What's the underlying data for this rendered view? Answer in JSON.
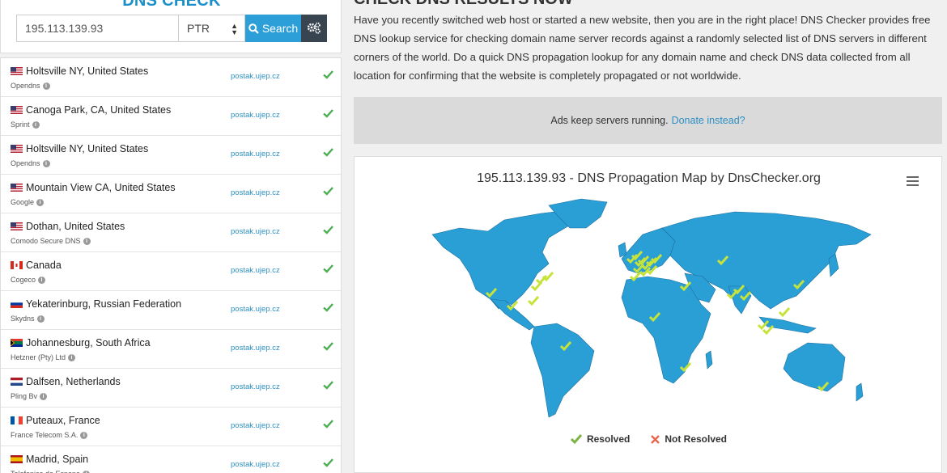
{
  "left": {
    "title": "DNS CHECK",
    "domain_value": "195.113.139.93",
    "record_type": "PTR",
    "search_label": "Search",
    "gear_icon": "gear-icon"
  },
  "results": [
    {
      "location": "Holtsville NY, United States",
      "provider": "Opendns",
      "result": "postak.ujep.cz",
      "flag": "us"
    },
    {
      "location": "Canoga Park, CA, United States",
      "provider": "Sprint",
      "result": "postak.ujep.cz",
      "flag": "us"
    },
    {
      "location": "Holtsville NY, United States",
      "provider": "Opendns",
      "result": "postak.ujep.cz",
      "flag": "us"
    },
    {
      "location": "Mountain View CA, United States",
      "provider": "Google",
      "result": "postak.ujep.cz",
      "flag": "us"
    },
    {
      "location": "Dothan, United States",
      "provider": "Comodo Secure DNS",
      "result": "postak.ujep.cz",
      "flag": "us"
    },
    {
      "location": "Canada",
      "provider": "Cogeco",
      "result": "postak.ujep.cz",
      "flag": "ca"
    },
    {
      "location": "Yekaterinburg, Russian Federation",
      "provider": "Skydns",
      "result": "postak.ujep.cz",
      "flag": "ru"
    },
    {
      "location": "Johannesburg, South Africa",
      "provider": "Hetzner (Pty) Ltd",
      "result": "postak.ujep.cz",
      "flag": "za"
    },
    {
      "location": "Dalfsen, Netherlands",
      "provider": "Pling Bv",
      "result": "postak.ujep.cz",
      "flag": "nl"
    },
    {
      "location": "Puteaux, France",
      "provider": "France Telecom S.A.",
      "result": "postak.ujep.cz",
      "flag": "fr"
    },
    {
      "location": "Madrid, Spain",
      "provider": "Telefonica de Espana",
      "result": "postak.ujep.cz",
      "flag": "es"
    }
  ],
  "right": {
    "title": "CHECK DNS RESULTS NOW",
    "intro": "Have you recently switched web host or started a new website, then you are in the right place! DNS Checker provides free DNS lookup service for checking domain name server records against a randomly selected list of DNS servers in different corners of the world. Do a quick DNS propagation lookup for any domain name and check DNS data collected from all location for confirming that the website is completely propagated or not worldwide.",
    "ads_text": "Ads keep servers running.",
    "ads_link": "Donate instead?",
    "map_title": "195.113.139.93 - DNS Propagation Map by DnsChecker.org",
    "legend_resolved": "Resolved",
    "legend_not_resolved": "Not Resolved"
  },
  "colors": {
    "accent": "#2c9ed8",
    "map_land": "#2a9fd6",
    "check_green": "#8bc34a",
    "not_resolved_red": "#e8664e"
  }
}
